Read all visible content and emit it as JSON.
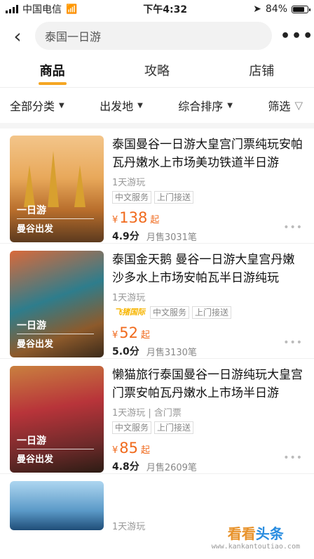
{
  "status": {
    "carrier": "中国电信",
    "time": "下午4:32",
    "battery": "84%",
    "battery_level": 0.84
  },
  "search": {
    "query": "泰国一日游"
  },
  "tabs": [
    {
      "label": "商品",
      "active": true
    },
    {
      "label": "攻略",
      "active": false
    },
    {
      "label": "店铺",
      "active": false
    }
  ],
  "filters": {
    "category": "全部分类",
    "departure": "出发地",
    "sort": "综合排序",
    "screen": "筛选"
  },
  "items": [
    {
      "badge1": "一日游",
      "badge2": "曼谷出发",
      "title": "泰国曼谷一日游大皇宫门票纯玩安帕瓦丹嫩水上市场美功铁道半日游",
      "sub": "1天游玩",
      "tags": [
        "中文服务",
        "上门接送"
      ],
      "currency": "¥",
      "price": "138",
      "price_suffix": "起",
      "score": "4.9分",
      "sold": "月售3031笔"
    },
    {
      "badge1": "一日游",
      "badge2": "曼谷出发",
      "title": "泰国金天鹅 曼谷一日游大皇宫丹嫩沙多水上市场安帕瓦半日游纯玩",
      "sub": "1天游玩",
      "brand": "飞猪国际",
      "tags": [
        "中文服务",
        "上门接送"
      ],
      "currency": "¥",
      "price": "52",
      "price_suffix": "起",
      "score": "5.0分",
      "sold": "月售3130笔"
    },
    {
      "badge1": "一日游",
      "badge2": "曼谷出发",
      "title": "懒猫旅行泰国曼谷一日游纯玩大皇宫门票安帕瓦丹嫩水上市场半日游",
      "sub": "1天游玩 | 含门票",
      "tags": [
        "中文服务",
        "上门接送"
      ],
      "currency": "¥",
      "price": "85",
      "price_suffix": "起",
      "score": "4.8分",
      "sold": "月售2609笔"
    }
  ],
  "partial_item": {
    "sub": "1天游玩"
  },
  "watermark": {
    "main_a": "看看",
    "main_b": "头条",
    "url": "www.kankantoutiao.com"
  }
}
